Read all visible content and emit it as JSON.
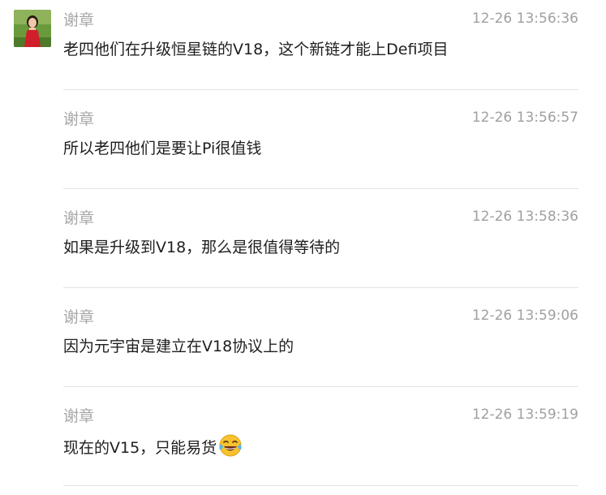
{
  "messages": [
    {
      "sender": "谢章",
      "time": "12-26 13:56:36",
      "text": "老四他们在升级恒星链的V18，这个新链才能上Defi项目"
    },
    {
      "sender": "谢章",
      "time": "12-26 13:56:57",
      "text": "所以老四他们是要让Pi很值钱"
    },
    {
      "sender": "谢章",
      "time": "12-26 13:58:36",
      "text": "如果是升级到V18，那么是很值得等待的"
    },
    {
      "sender": "谢章",
      "time": "12-26 13:59:06",
      "text": "因为元宇宙是建立在V18协议上的"
    },
    {
      "sender": "谢章",
      "time": "12-26 13:59:19",
      "text": "现在的V15，只能易货",
      "emoji": "tears-of-joy-emoji"
    }
  ]
}
